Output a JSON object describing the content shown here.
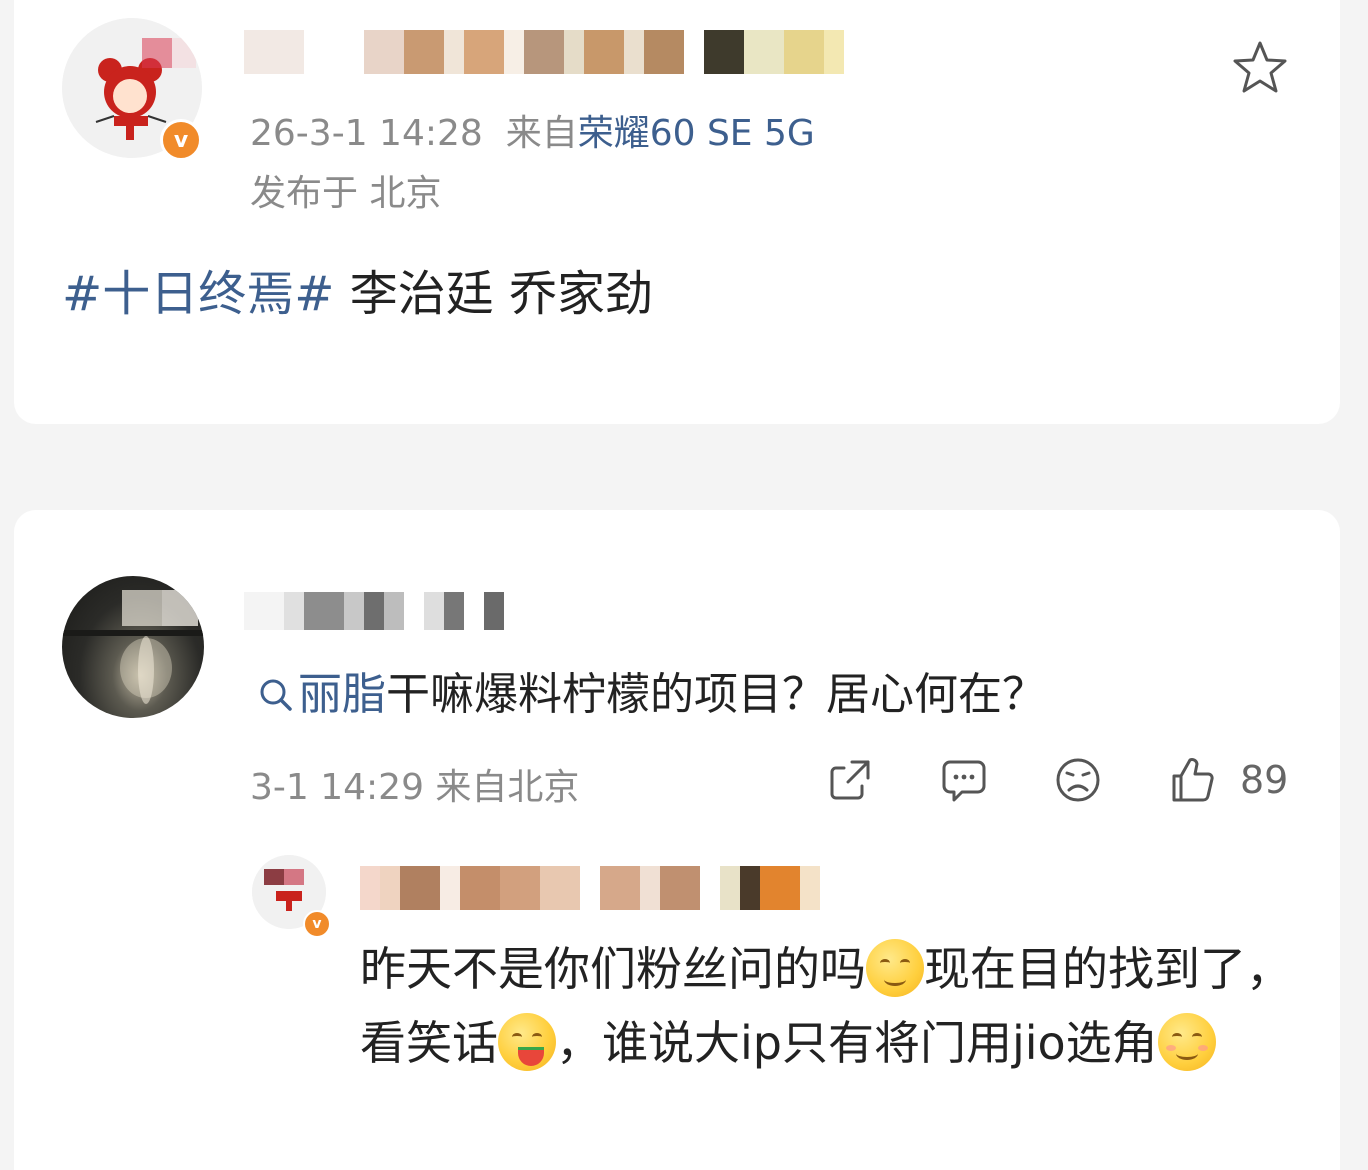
{
  "post": {
    "timestamp": "26-3-1 14:28",
    "source_prefix": "来自",
    "device": "荣耀60 SE 5G",
    "location": "发布于 北京",
    "topic": "#十日终焉#",
    "text": " 李治廷 乔家劲",
    "star_icon": "star-outline-icon"
  },
  "comment": {
    "search_keyword": "丽脂",
    "text": "干嘛爆料柠檬的项目？居心何在？",
    "meta": "3-1 14:29 来自北京",
    "like_count": "89",
    "icons": [
      "share-icon",
      "comment-icon",
      "dislike-icon",
      "like-icon"
    ]
  },
  "reply": {
    "part1": "昨天不是你们粉丝问的吗",
    "part2": "现在目的找到了，看笑话",
    "part3": "，谁说大ip只有将门用jio选角",
    "emojis": [
      "confused-grin-emoji",
      "eating-watermelon-emoji",
      "smile-emoji"
    ]
  },
  "colors": {
    "link": "#3d5f8e",
    "badge": "#f18b2a",
    "meta": "#8a8a8a",
    "background": "#f4f4f4"
  }
}
